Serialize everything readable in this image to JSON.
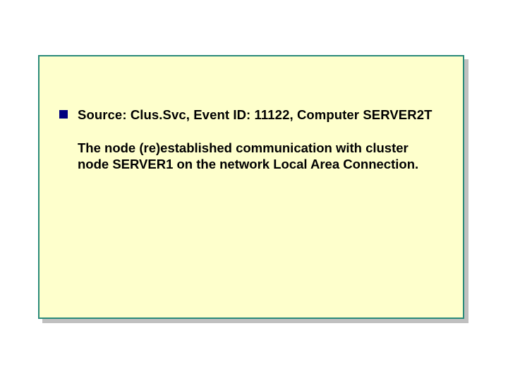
{
  "slide": {
    "heading": "Source: Clus.Svc, Event ID: 11122, Computer SERVER2T",
    "body": "The node (re)established communication with cluster node SERVER1 on the network Local Area Connection."
  }
}
